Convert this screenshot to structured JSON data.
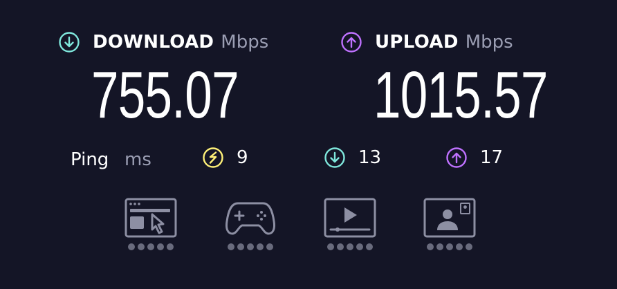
{
  "download": {
    "title": "DOWNLOAD",
    "unit": "Mbps",
    "value": "755.07",
    "icon": "arrow-down-circle-icon",
    "color": "#7fe7dc"
  },
  "upload": {
    "title": "UPLOAD",
    "unit": "Mbps",
    "value": "1015.57",
    "icon": "arrow-up-circle-icon",
    "color": "#bf71ff"
  },
  "ping": {
    "label": "Ping",
    "unit": "ms",
    "idle": {
      "value": "9",
      "icon": "idle-latency-icon",
      "color": "#fff178"
    },
    "download": {
      "value": "13",
      "icon": "arrow-down-circle-icon",
      "color": "#7fe7dc"
    },
    "upload": {
      "value": "17",
      "icon": "arrow-up-circle-icon",
      "color": "#bf71ff"
    }
  },
  "activities": [
    {
      "icon": "web-browsing-icon"
    },
    {
      "icon": "gaming-controller-icon"
    },
    {
      "icon": "video-streaming-icon"
    },
    {
      "icon": "video-chat-icon"
    }
  ],
  "colors": {
    "background": "#141526",
    "muted": "#9b9eb3",
    "activity": "#8d8fa3",
    "dot": "#696b7d"
  }
}
